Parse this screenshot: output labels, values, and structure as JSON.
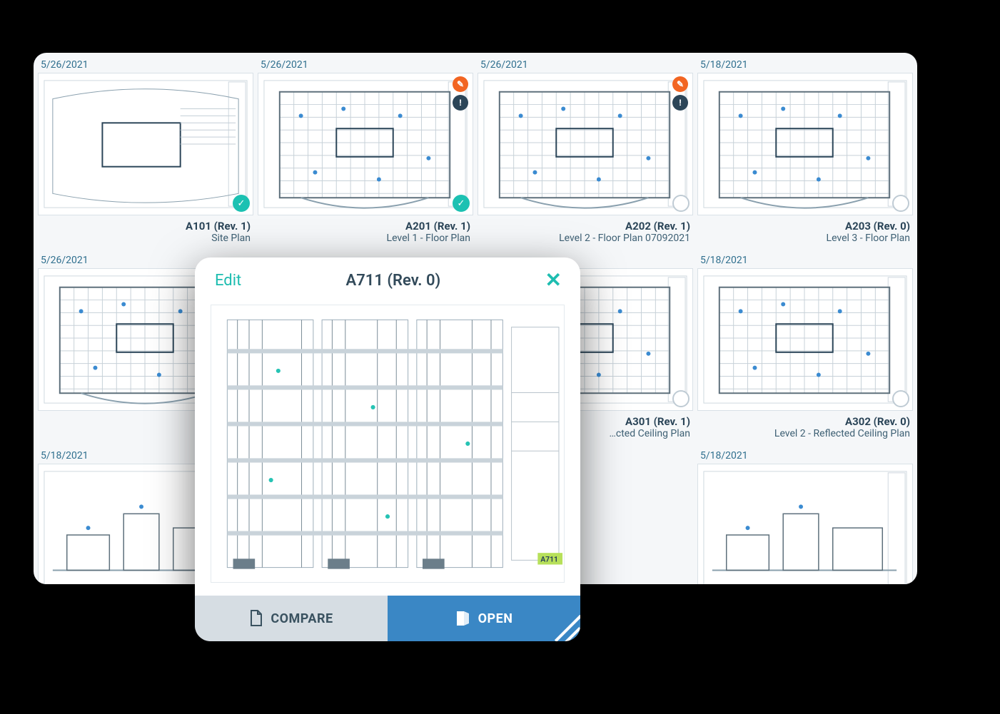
{
  "popup": {
    "edit": "Edit",
    "title": "A711 (Rev. 0)",
    "compare": "COMPARE",
    "open": "OPEN"
  },
  "cards": [
    {
      "date": "5/26/2021",
      "title": "A101 (Rev. 1)",
      "subtitle": "Site Plan",
      "selected": true,
      "edit": false,
      "alert": false
    },
    {
      "date": "5/26/2021",
      "title": "A201 (Rev. 1)",
      "subtitle": "Level 1 - Floor Plan",
      "selected": true,
      "edit": true,
      "alert": true
    },
    {
      "date": "5/26/2021",
      "title": "A202 (Rev. 1)",
      "subtitle": "Level 2 - Floor Plan 07092021",
      "selected": false,
      "edit": true,
      "alert": true
    },
    {
      "date": "5/18/2021",
      "title": "A203 (Rev. 0)",
      "subtitle": "Level 3 - Floor Plan",
      "selected": false,
      "edit": false,
      "alert": false
    },
    {
      "date": "5/26/2021",
      "title": "",
      "subtitle": "",
      "selected": false,
      "edit": false,
      "alert": false,
      "no_tick": true
    },
    {
      "date": "",
      "title": "",
      "subtitle": "",
      "selected": false,
      "edit": false,
      "alert": false,
      "no_tick": true,
      "placeholder": true
    },
    {
      "date": "",
      "title": "A301 (Rev. 1)",
      "subtitle": "…cted Ceiling Plan",
      "selected": false,
      "edit": false,
      "alert": false
    },
    {
      "date": "5/18/2021",
      "title": "A302 (Rev. 0)",
      "subtitle": "Level 2 - Reflected Ceiling Plan",
      "selected": false,
      "edit": false,
      "alert": false
    },
    {
      "date": "5/18/2021",
      "title": "",
      "subtitle": "",
      "selected": false,
      "edit": false,
      "alert": false,
      "no_tick": true
    },
    {
      "date": "",
      "title": "",
      "subtitle": "",
      "selected": false,
      "edit": false,
      "alert": false,
      "no_tick": true,
      "placeholder": true
    },
    {
      "date": "",
      "title": "",
      "subtitle": "",
      "selected": false,
      "edit": false,
      "alert": false,
      "no_tick": true,
      "placeholder": true
    },
    {
      "date": "5/18/2021",
      "title": "",
      "subtitle": "",
      "selected": false,
      "edit": false,
      "alert": false,
      "no_tick": true
    }
  ]
}
